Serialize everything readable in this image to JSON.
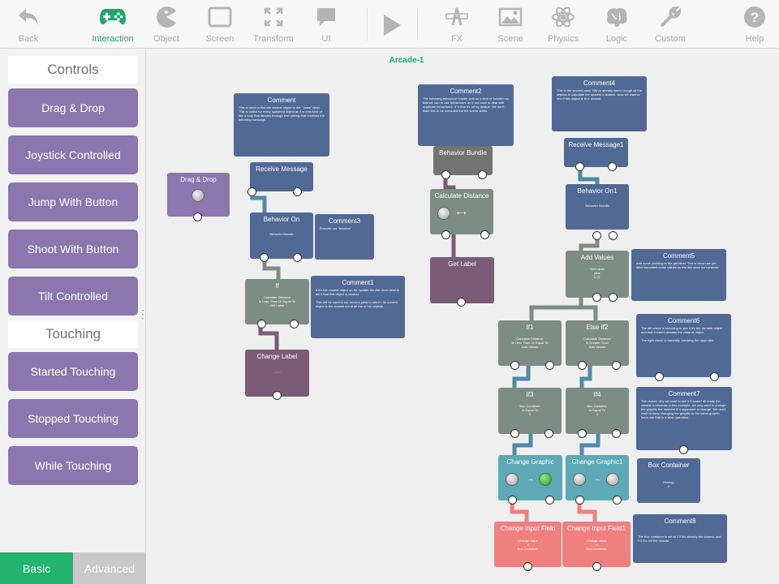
{
  "toolbar": {
    "back": "Back",
    "interaction": "Interaction",
    "object": "Object",
    "screen": "Screen",
    "transform": "Transform",
    "ui": "UI",
    "fx": "FX",
    "scene": "Scene",
    "physics": "Physics",
    "logic": "Logic",
    "custom": "Custom",
    "help": "Help",
    "accent": "#20a86b"
  },
  "sidebar": {
    "controls_heading": "Controls",
    "controls": [
      "Drag & Drop",
      "Joystick Controlled",
      "Jump With Button",
      "Shoot With Button",
      "Tilt Controlled"
    ],
    "touching_heading": "Touching",
    "touching": [
      "Started Touching",
      "Stopped Touching",
      "While Touching"
    ],
    "tabs": {
      "basic": "Basic",
      "advanced": "Advanced"
    }
  },
  "canvas": {
    "scene_title": "Arcade-1",
    "nodes": {
      "comment": {
        "title": "Comment",
        "body": "This is used to find the closest object to the \" base\" label.\n\nThis is called for every spawned object as it w orks kind of like a loop that iterates through eve rything that receives the following message."
      },
      "drag_drop": {
        "title": "Drag & Drop"
      },
      "receive_message": {
        "title": "Receive Message"
      },
      "behavior_on": {
        "title": "Behavior On",
        "body": "Behavior Bundle"
      },
      "comment3": {
        "title": "Comment3",
        "body": "Execute our \"function\""
      },
      "if": {
        "title": "If",
        "body": "Calculate Distance\nIs Less Than Or Equal To\nGet Label"
      },
      "comment1": {
        "title": "Comment1",
        "body": "If it's the closest object so far, update the dist ance label to tell it that this object is closest.\n\nThis will be used in our second pass to see if t he current object is the closest out of all the ot her objects."
      },
      "change_label": {
        "title": "Change Label",
        "body": "Label"
      },
      "comment2": {
        "title": "Comment2",
        "body": "The following behaviour bundle acts as a kind of function so that we can re-use behaviours an d not have to deal with duplicate behaviours. It 's that it's off by default. We don't want this to be executed the the scene starts."
      },
      "behavior_bundle": {
        "title": "Behavior Bundle"
      },
      "calculate_distance": {
        "title": "Calculate Distance"
      },
      "get_label": {
        "title": "Get Label"
      },
      "comment4": {
        "title": "Comment4",
        "body": "This is the second pass. We've already went t hough all the objects to calculate the nearest d istance. Now we want to see if this object is th e closest."
      },
      "receive_message1": {
        "title": "Receive Message1"
      },
      "behavior_on1": {
        "title": "Behavior On1",
        "body": "Behavior Bundle"
      },
      "add_values": {
        "title": "Add Values",
        "body": "Get Label\nplus\n0.01"
      },
      "comment5": {
        "title": "Comment5",
        "body": "Add some padding to the get label. This is beca use get label truncated some values so the dist ance isn't precise."
      },
      "if1": {
        "title": "If1",
        "body": "Calculate Distance\nIs Less Than Or Equal To\nAdd Values"
      },
      "else_if2": {
        "title": "Else If2",
        "body": "Calculate Distance\nIs Greater Than\nAdd Values"
      },
      "comment6": {
        "title": "Comment6",
        "body": "The left check is checking to see if it's the clo sest object and that it wasn't already the close st object.\n\nThe right check is basically checking the oppo site."
      },
      "if3": {
        "title": "If3",
        "body": "Box Container\nIs Equal To\n0"
      },
      "if4": {
        "title": "If4",
        "body": "Box Container\nIs Equal To\n1"
      },
      "comment7": {
        "title": "Comment7",
        "body": "The reason why we want to see if it wasn't all ready the closest is because in this example, we only want to change the graphic the moment it' s supposed to change. We don't want to keep changing the graphic to the same graphic beca use that is a slow operation."
      },
      "change_graphic": {
        "title": "Change Graphic"
      },
      "change_graphic1": {
        "title": "Change Graphic1"
      },
      "box_container": {
        "title": "Box Container",
        "body": "Storing:\n0"
      },
      "change_input_field": {
        "title": "Change Input Field",
        "body": "Change value\nof\nBox Container"
      },
      "change_input_field1": {
        "title": "Change Input Field1",
        "body": "Change value\nof\nBox Container"
      },
      "comment8": {
        "title": "Comment8",
        "body": "The box container is set to 1 if it's already the closest, and 0 if it's not the closest."
      }
    }
  }
}
